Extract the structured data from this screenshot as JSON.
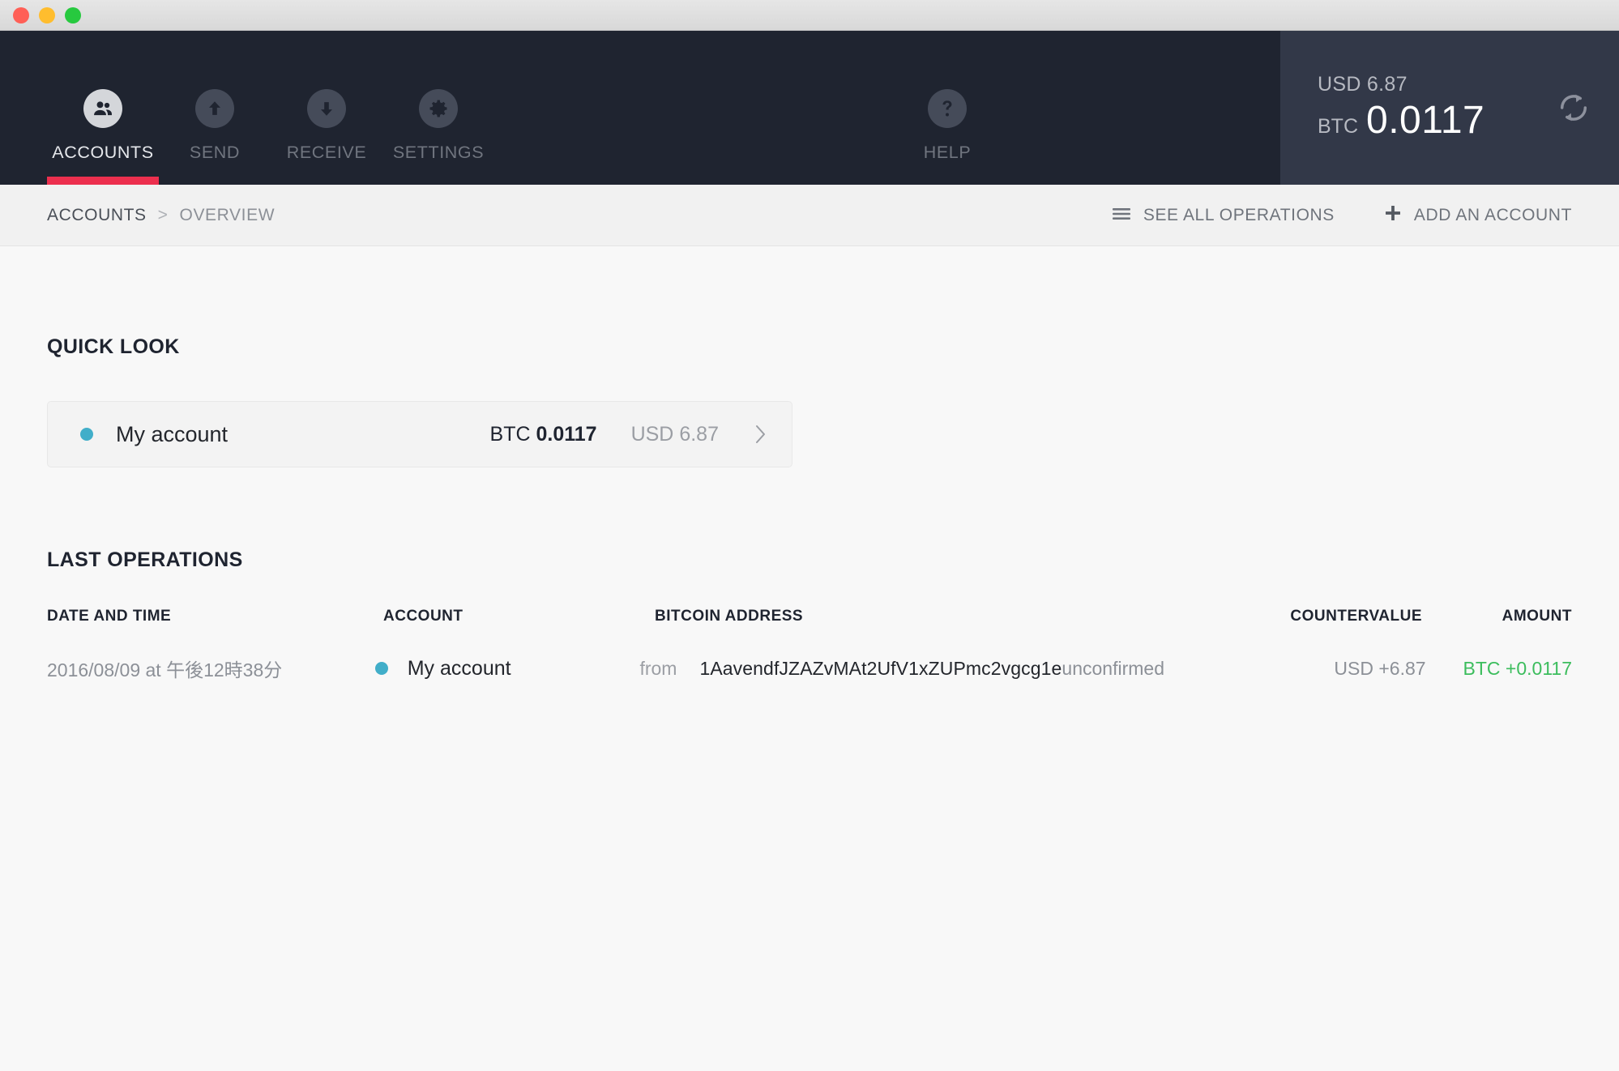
{
  "window": {
    "traffic_lights": [
      "close",
      "minimize",
      "maximize"
    ]
  },
  "topnav": {
    "items": [
      {
        "label": "ACCOUNTS",
        "icon": "people-icon",
        "active": true
      },
      {
        "label": "SEND",
        "icon": "arrow-up-icon",
        "active": false
      },
      {
        "label": "RECEIVE",
        "icon": "arrow-down-icon",
        "active": false
      },
      {
        "label": "SETTINGS",
        "icon": "gear-icon",
        "active": false
      }
    ],
    "help": {
      "label": "HELP",
      "icon": "question-mark-icon"
    },
    "active_accent": "#ec2f4e"
  },
  "balance": {
    "fiat_label": "USD",
    "fiat_value": "6.87",
    "fiat_line": "USD 6.87",
    "crypto_unit": "BTC",
    "crypto_value": "0.0117",
    "refresh_icon": "sync-refresh-icon"
  },
  "breadcrumb": {
    "root": "ACCOUNTS",
    "separator": ">",
    "current": "OVERVIEW",
    "actions": [
      {
        "label": "SEE ALL OPERATIONS",
        "icon": "hamburger-icon"
      },
      {
        "label": "ADD AN ACCOUNT",
        "icon": "plus-icon"
      }
    ]
  },
  "quick_look": {
    "title": "QUICK LOOK",
    "accounts": [
      {
        "dot_color": "#41aec9",
        "name": "My account",
        "btc_label": "BTC",
        "btc_value": "0.0117",
        "fiat_label": "USD",
        "fiat_value": "6.87",
        "chevron_icon": "chevron-right-icon"
      }
    ]
  },
  "last_operations": {
    "title": "LAST OPERATIONS",
    "columns": [
      "DATE AND TIME",
      "ACCOUNT",
      "BITCOIN ADDRESS",
      "COUNTERVALUE",
      "AMOUNT"
    ],
    "rows": [
      {
        "datetime": "2016/08/09 at 午後12時38分",
        "dot_color": "#41aec9",
        "account": "My account",
        "direction": "from",
        "address": "1AavendfJZAZvMAt2UfV1xZUPmc2vgcg1e",
        "status": "unconfirmed",
        "countervalue": "USD +6.87",
        "amount": "BTC +0.0117",
        "amount_color": "#3cbd5d"
      }
    ]
  }
}
